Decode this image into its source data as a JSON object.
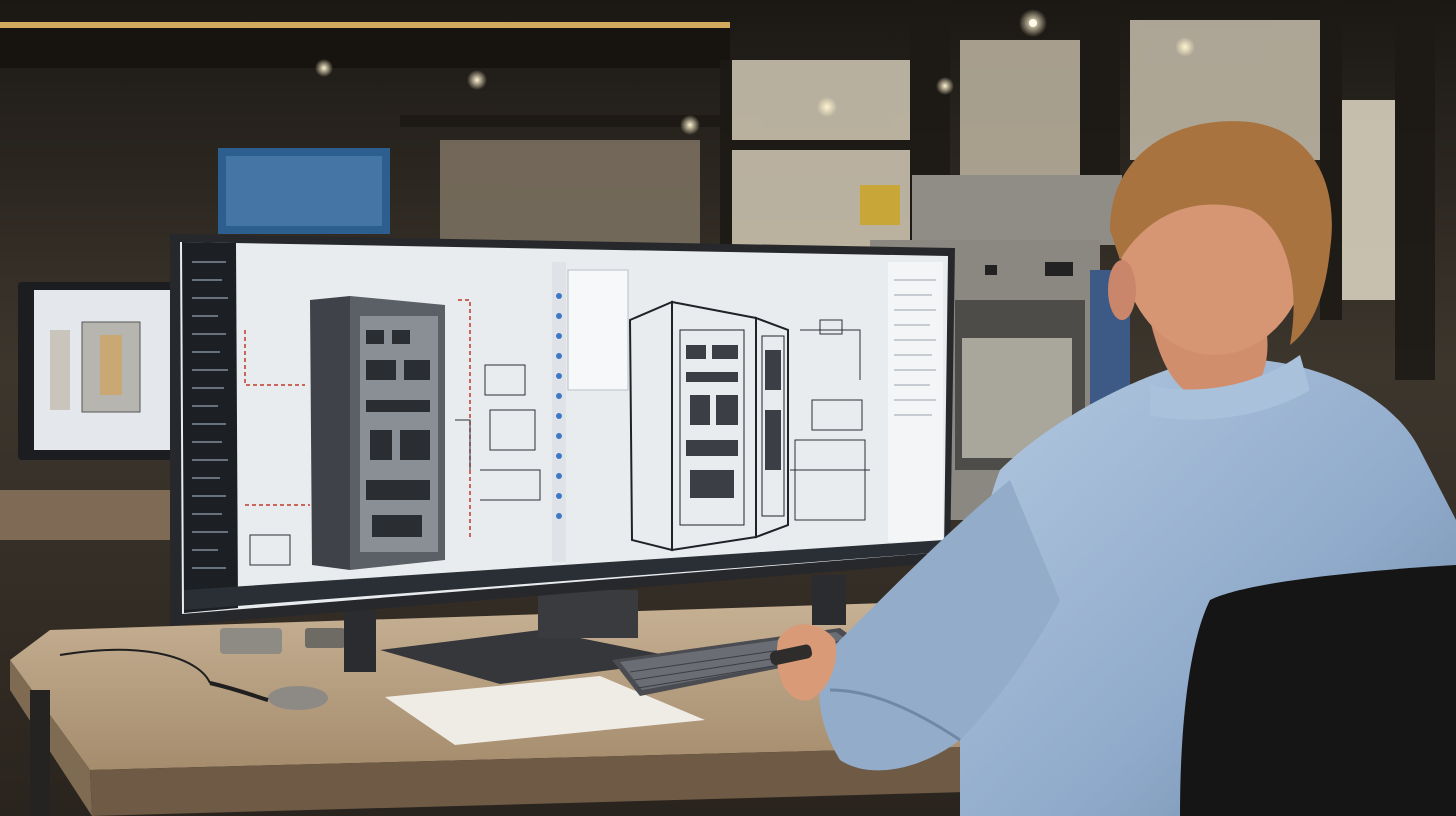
{
  "scene": {
    "subject": "engineer-at-cad-workstation",
    "colors": {
      "wall": "#3a342c",
      "ceiling": "#1e1a16",
      "desk_top": "#b8a184",
      "desk_edge": "#8a7258",
      "screen_bg": "#e9ecef",
      "sidebar": "#1c1f24",
      "shirt": "#9fb8d4",
      "shirt_shadow": "#6f88a6",
      "hair": "#a8733f",
      "skin": "#d99a78",
      "drawing_line": "#2b2f36",
      "redline": "#c0392b",
      "monitor_frame": "#26282c",
      "chair": "#151515",
      "warm_light": "#f2c46b"
    },
    "icons": [
      "desk-lamp-light",
      "keyboard-icon",
      "wristwatch-icon",
      "mouse-cable-icon"
    ]
  }
}
